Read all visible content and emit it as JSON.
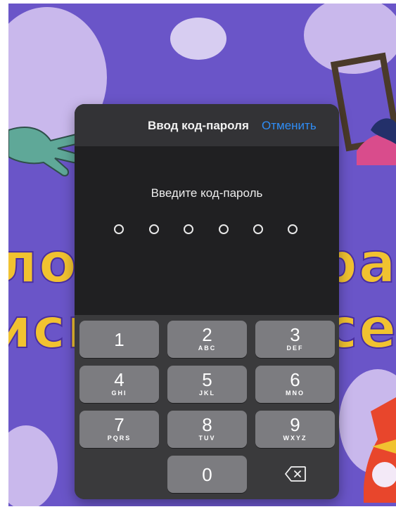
{
  "dialog": {
    "title": "Ввод код-пароля",
    "cancel_label": "Отменить",
    "prompt": "Введите код-пароль",
    "passcode_length": 6,
    "entered_digits": 0
  },
  "background_text": {
    "line1_left": "лож",
    "line1_right": "рас",
    "line2_left": "исп",
    "line2_right": "сер"
  },
  "keypad": {
    "keys": [
      {
        "digit": "1",
        "letters": ""
      },
      {
        "digit": "2",
        "letters": "ABC"
      },
      {
        "digit": "3",
        "letters": "DEF"
      },
      {
        "digit": "4",
        "letters": "GHI"
      },
      {
        "digit": "5",
        "letters": "JKL"
      },
      {
        "digit": "6",
        "letters": "MNO"
      },
      {
        "digit": "7",
        "letters": "PQRS"
      },
      {
        "digit": "8",
        "letters": "TUV"
      },
      {
        "digit": "9",
        "letters": "WXYZ"
      },
      {
        "digit": "0",
        "letters": ""
      }
    ],
    "delete_icon": "backspace-icon"
  },
  "colors": {
    "accent": "#2f8df5",
    "wallpaper": "#6a55c8",
    "wallpaper_text": "#f1c230",
    "key": "#7c7c80"
  }
}
